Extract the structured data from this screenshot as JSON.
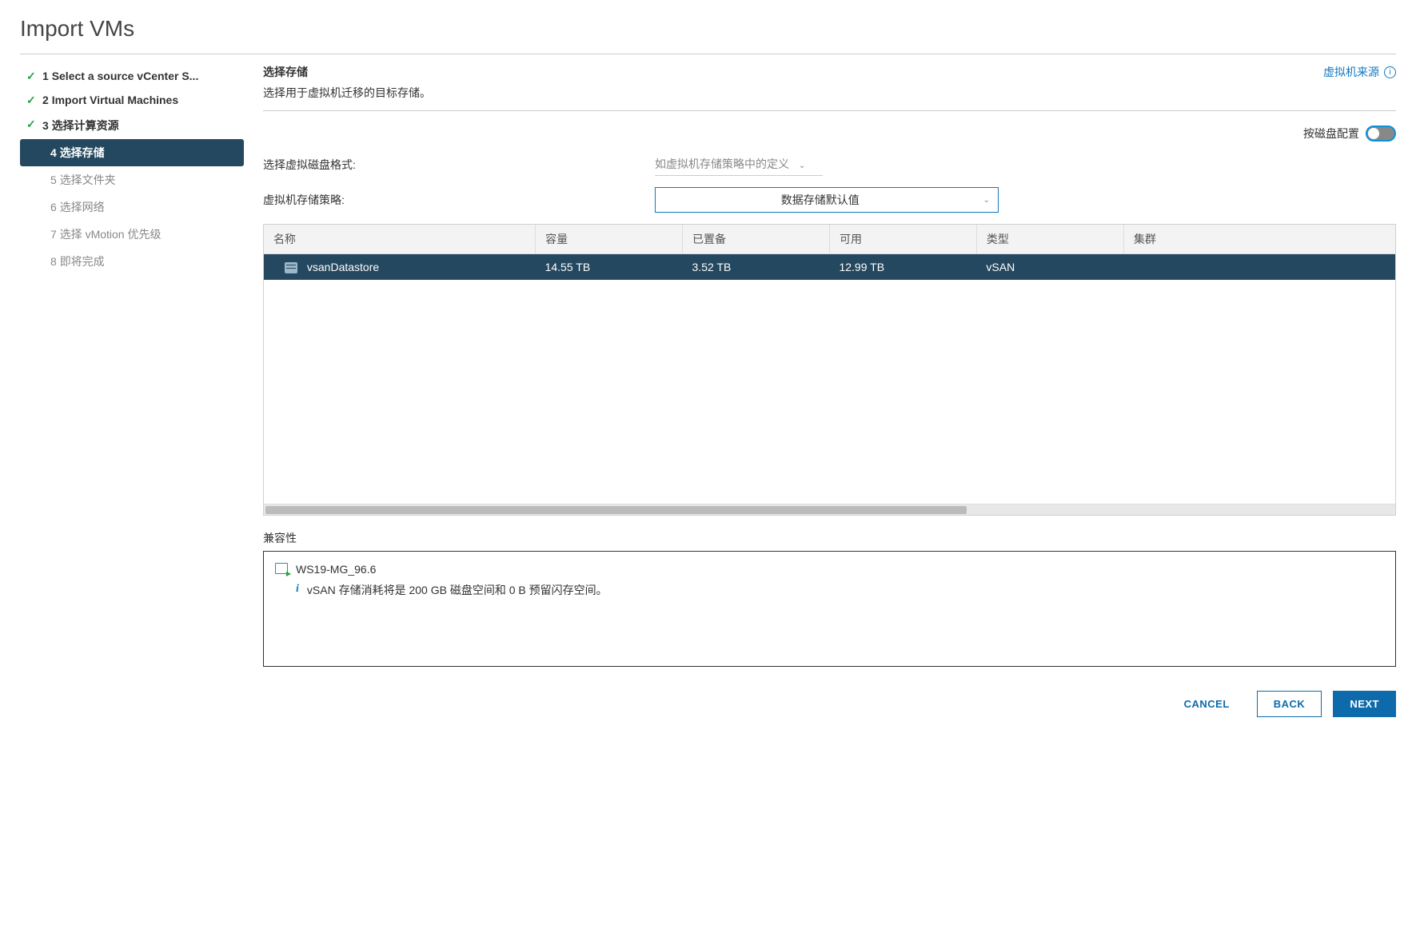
{
  "page_title": "Import VMs",
  "steps": [
    {
      "num": "1",
      "label": "Select a source vCenter S...",
      "state": "completed"
    },
    {
      "num": "2",
      "label": "Import Virtual Machines",
      "state": "completed"
    },
    {
      "num": "3",
      "label": "选择计算资源",
      "state": "completed"
    },
    {
      "num": "4",
      "label": "选择存储",
      "state": "active"
    },
    {
      "num": "5",
      "label": "选择文件夹",
      "state": "pending"
    },
    {
      "num": "6",
      "label": "选择网络",
      "state": "pending"
    },
    {
      "num": "7",
      "label": "选择 vMotion 优先级",
      "state": "pending"
    },
    {
      "num": "8",
      "label": "即将完成",
      "state": "pending"
    }
  ],
  "section": {
    "title": "选择存储",
    "desc": "选择用于虚拟机迁移的目标存储。",
    "vm_source_link": "虚拟机来源"
  },
  "toggle": {
    "label": "按磁盘配置"
  },
  "disk_format": {
    "label": "选择虚拟磁盘格式:",
    "value": "如虚拟机存储策略中的定义"
  },
  "storage_policy": {
    "label": "虚拟机存储策略:",
    "value": "数据存储默认值"
  },
  "table": {
    "headers": {
      "name": "名称",
      "capacity": "容量",
      "provisioned": "已置备",
      "free": "可用",
      "type": "类型",
      "cluster": "集群"
    },
    "rows": [
      {
        "name": "vsanDatastore",
        "capacity": "14.55 TB",
        "provisioned": "3.52 TB",
        "free": "12.99 TB",
        "type": "vSAN",
        "cluster": ""
      }
    ]
  },
  "compat": {
    "title": "兼容性",
    "vm_name": "WS19-MG_96.6",
    "detail": "vSAN 存储消耗将是 200 GB 磁盘空间和 0 B 预留闪存空间。"
  },
  "buttons": {
    "cancel": "CANCEL",
    "back": "BACK",
    "next": "NEXT"
  }
}
